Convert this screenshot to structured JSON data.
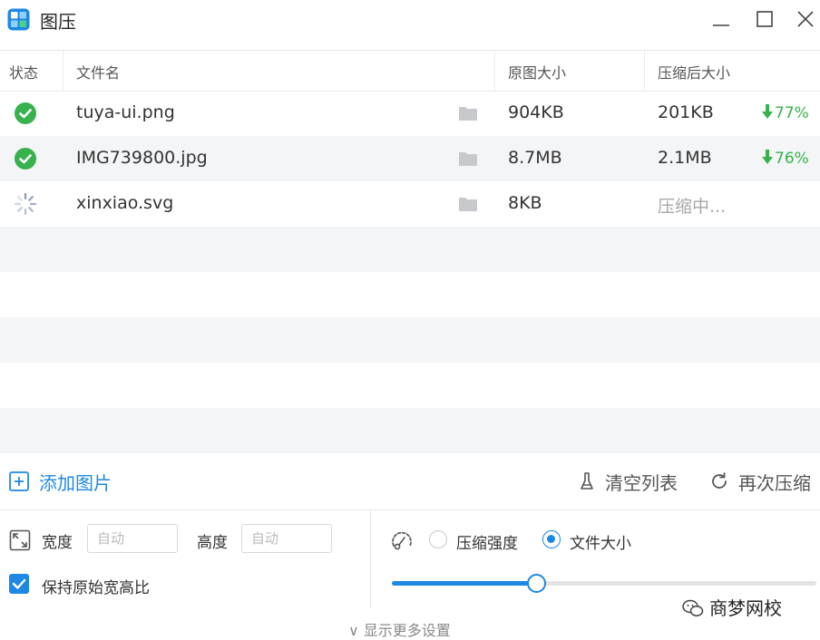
{
  "app": {
    "title": "图压"
  },
  "table": {
    "headers": {
      "status": "状态",
      "name": "文件名",
      "orig": "原图大小",
      "compressed": "压缩后大小"
    },
    "rows": [
      {
        "status": "done",
        "name": "tuya-ui.png",
        "orig": "904KB",
        "compressed": "201KB",
        "pct": "77%"
      },
      {
        "status": "done",
        "name": "IMG739800.jpg",
        "orig": "8.7MB",
        "compressed": "2.1MB",
        "pct": "76%"
      },
      {
        "status": "loading",
        "name": "xinxiao.svg",
        "orig": "8KB",
        "compressed": "压缩中...",
        "pct": ""
      }
    ]
  },
  "actions": {
    "add": "添加图片",
    "clear": "清空列表",
    "recompress": "再次压缩"
  },
  "settings": {
    "width_label": "宽度",
    "width_placeholder": "自动",
    "height_label": "高度",
    "height_placeholder": "自动",
    "keep_ratio_label": "保持原始宽高比",
    "keep_ratio_checked": true,
    "mode_strength_label": "压缩强度",
    "mode_size_label": "文件大小",
    "mode_selected": "size",
    "slider_value": 0.34,
    "more_label": "∨ 显示更多设置"
  },
  "watermark": {
    "text": "商梦网校"
  },
  "colors": {
    "accent": "#1e88e5",
    "success": "#37b24d"
  },
  "icons": {
    "app": "app-icon",
    "status_done": "check-circle-icon",
    "status_loading": "spinner-icon",
    "folder": "folder-icon",
    "arrow": "arrow-down-icon"
  }
}
